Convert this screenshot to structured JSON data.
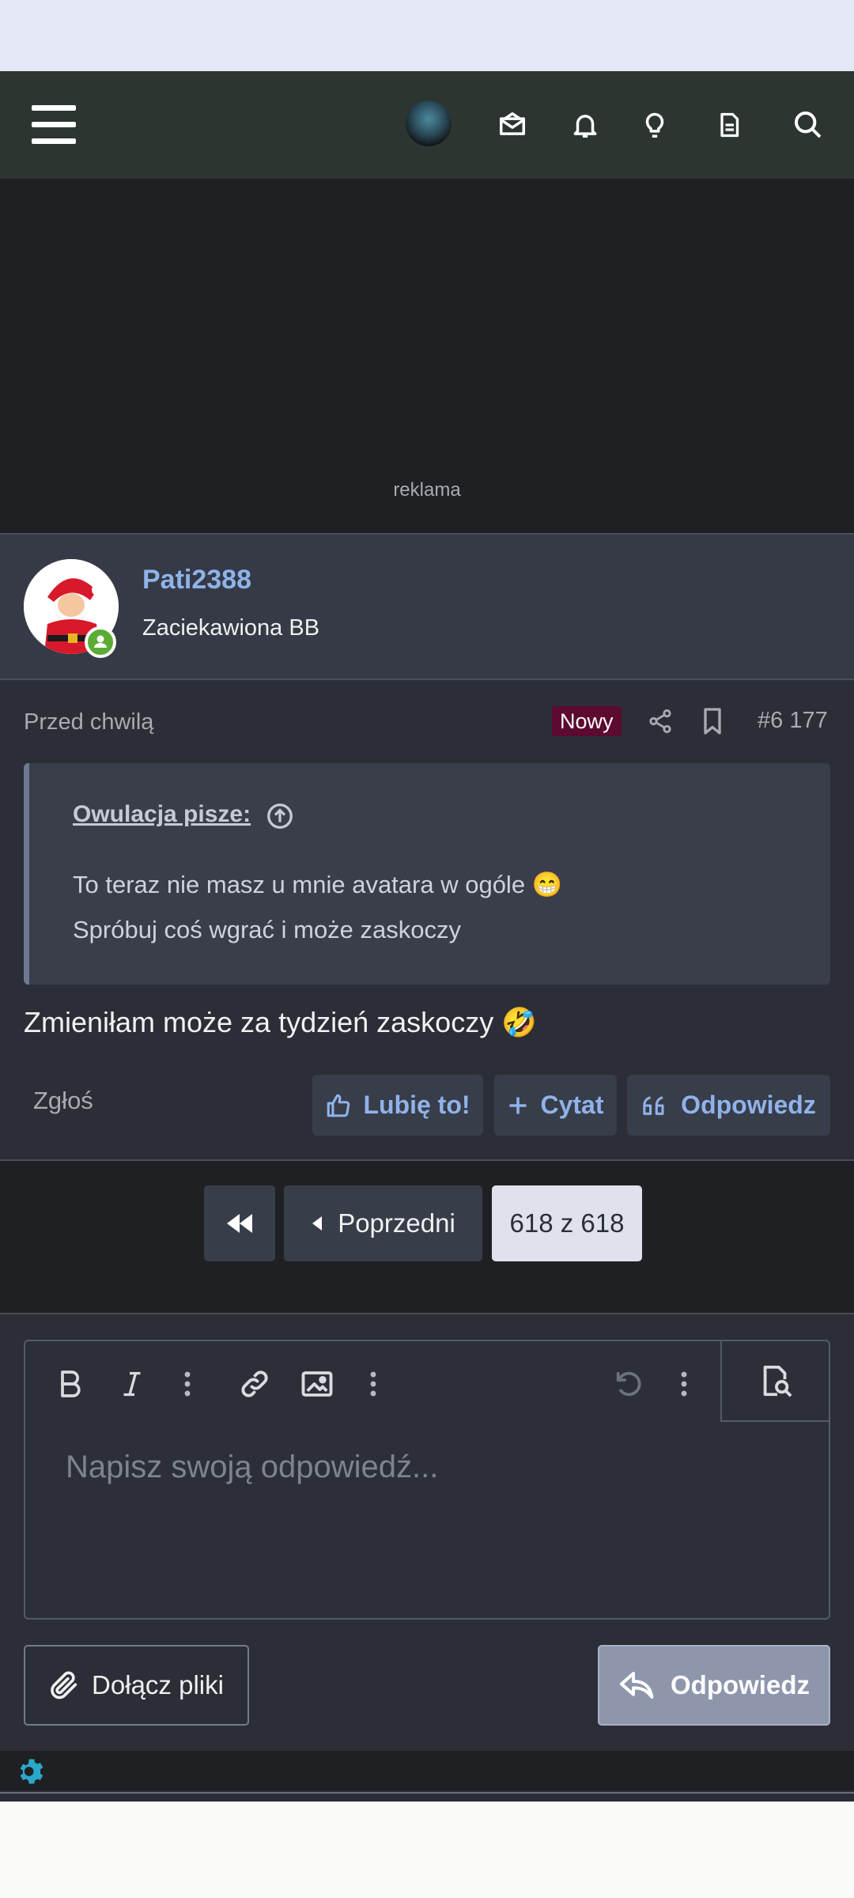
{
  "nav": {
    "icons": [
      "menu-icon",
      "avatar",
      "mail-icon",
      "bell-icon",
      "lightbulb-icon",
      "document-icon",
      "search-icon"
    ]
  },
  "ad": {
    "label": "reklama"
  },
  "user": {
    "name": "Pati2388",
    "title": "Zaciekawiona BB"
  },
  "post": {
    "time": "Przed chwilą",
    "badge": "Nowy",
    "number": "#6 177",
    "quote": {
      "author": "Owulacja pisze:",
      "line1": "To teraz nie masz u mnie avatara w ogóle 😁",
      "line2": "Spróbuj coś wgrać i może zaskoczy"
    },
    "message": "Zmieniłam może za tydzień zaskoczy 🤣",
    "report": "Zgłoś",
    "like": "Lubię to!",
    "quote_btn": "Cytat",
    "reply_btn": "Odpowiedz"
  },
  "pager": {
    "prev": "Poprzedni",
    "current": "618 z 618"
  },
  "editor": {
    "placeholder": "Napisz swoją odpowiedź...",
    "attach": "Dołącz pliki",
    "submit": "Odpowiedz"
  },
  "colors": {
    "accent": "#8fb3ea",
    "new_badge": "#5c0a2f",
    "online": "#5aac33",
    "gear": "#2aa7c9"
  }
}
